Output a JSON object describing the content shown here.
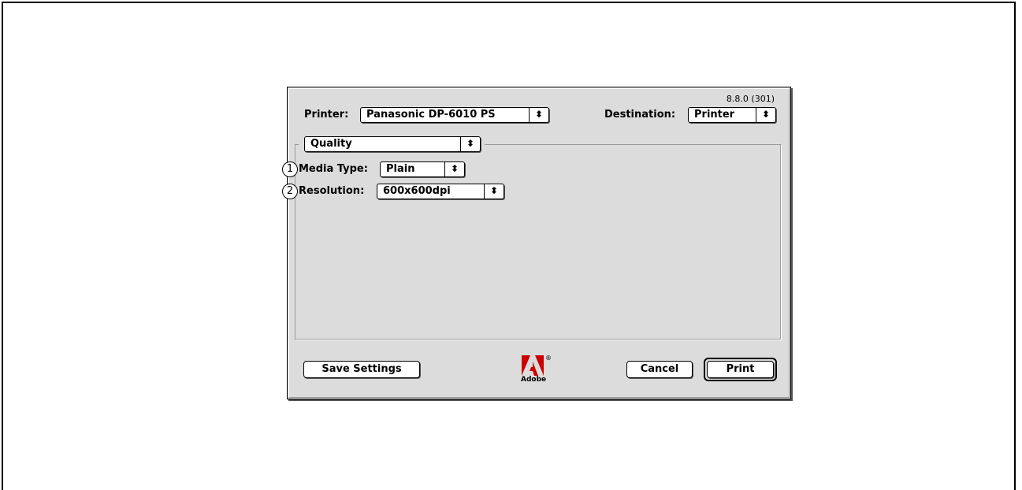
{
  "dialog": {
    "version": "8.8.0 (301)",
    "printer_label": "Printer:",
    "printer_value": "Panasonic DP-6010 PS",
    "destination_label": "Destination:",
    "destination_value": "Printer",
    "panel_value": "Quality",
    "media_type": {
      "number": "1",
      "label": "Media Type:",
      "value": "Plain"
    },
    "resolution": {
      "number": "2",
      "label": "Resolution:",
      "value": "600x600dpi"
    },
    "logo_text": "Adobe",
    "logo_mark": "®",
    "save_settings_label": "Save Settings",
    "cancel_label": "Cancel",
    "print_label": "Print",
    "popup_arrow_glyph": "⬍"
  }
}
